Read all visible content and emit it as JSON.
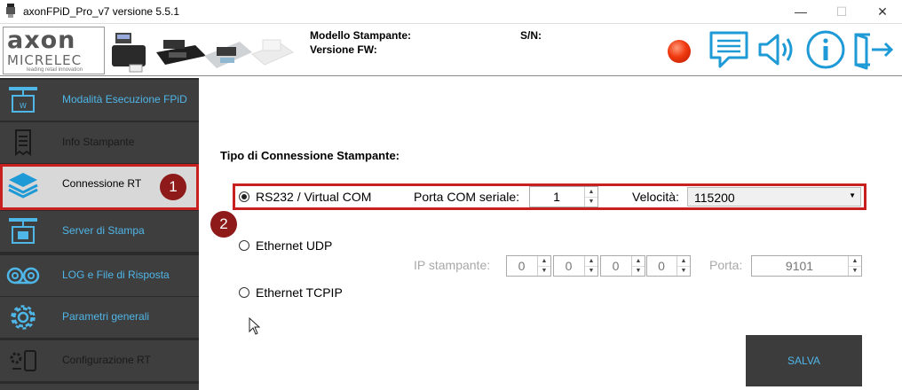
{
  "window": {
    "title": "axonFPiD_Pro_v7 versione 5.5.1",
    "minimize": "—",
    "maximize": "☐",
    "close": "✕"
  },
  "header": {
    "logo_line1": "axon",
    "logo_line2": "MICRELEC",
    "logo_tagline": "leading retail innovation",
    "modello_label": "Modello Stampante:",
    "versione_label": "Versione FW:",
    "sn_label": "S/N:",
    "status_color": "#e8401c",
    "icons": [
      "message-icon",
      "speaker-icon",
      "info-icon",
      "exit-icon"
    ]
  },
  "sidebar": {
    "items": [
      {
        "label": "Modalità Esecuzione FPiD",
        "icon": "printer-network-icon",
        "state": "normal"
      },
      {
        "label": "Info Stampante",
        "icon": "receipt-icon",
        "state": "disabled"
      },
      {
        "label": "Connessione RT",
        "icon": "layers-icon",
        "state": "active"
      },
      {
        "label": "Server di Stampa",
        "icon": "print-server-icon",
        "state": "normal"
      },
      {
        "label": "LOG e File di Risposta",
        "icon": "tape-icon",
        "state": "normal"
      },
      {
        "label": "Parametri generali",
        "icon": "gear-icon",
        "state": "normal"
      },
      {
        "label": "Configurazione RT",
        "icon": "config-icon",
        "state": "disabled"
      }
    ]
  },
  "annotations": {
    "badge1": "1",
    "badge2": "2",
    "color": "#8e1a1a",
    "highlight_color": "#c81f1f"
  },
  "main": {
    "section_title": "Tipo di Connessione Stampante:",
    "rs232": {
      "label": "RS232 / Virtual COM",
      "selected": true,
      "porta_label": "Porta COM seriale:",
      "porta_value": "1",
      "velocita_label": "Velocità:",
      "velocita_value": "115200"
    },
    "udp": {
      "label": "Ethernet UDP",
      "selected": false,
      "ip_label": "IP stampante:",
      "ip": [
        "0",
        "0",
        "0",
        "0"
      ],
      "porta_label": "Porta:",
      "porta_value": "9101"
    },
    "tcpip": {
      "label": "Ethernet TCPIP",
      "selected": false
    },
    "save_label": "SALVA"
  }
}
